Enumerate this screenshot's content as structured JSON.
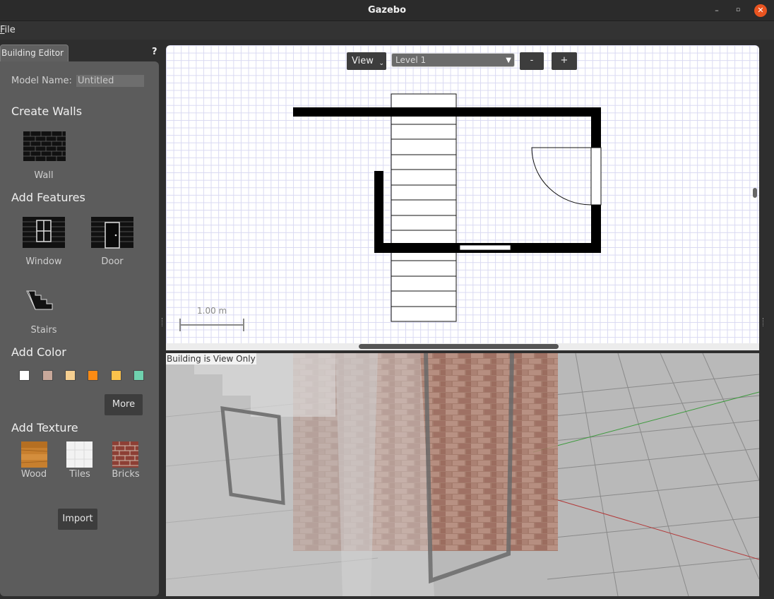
{
  "window": {
    "title": "Gazebo",
    "minimize_label": "–",
    "maximize_label": "▫",
    "close_label": "✕"
  },
  "menu": {
    "file_first": "F",
    "file_rest": "ile"
  },
  "tab": {
    "label": "Building Editor",
    "help_label": "?"
  },
  "panel": {
    "model_name_label": "Model Name:",
    "model_name_value": "Untitled",
    "create_walls_title": "Create Walls",
    "wall_label": "Wall",
    "add_features_title": "Add Features",
    "window_label": "Window",
    "door_label": "Door",
    "stairs_label": "Stairs",
    "add_color_title": "Add Color",
    "colors": [
      "#ffffff",
      "#c8a89a",
      "#f5cf91",
      "#fb8b14",
      "#fbc24b",
      "#6fd1ae"
    ],
    "more_label": "More",
    "add_texture_title": "Add Texture",
    "textures": [
      {
        "label": "Wood",
        "icon": "wood-texture-icon"
      },
      {
        "label": "Tiles",
        "icon": "tiles-texture-icon"
      },
      {
        "label": "Bricks",
        "icon": "bricks-texture-icon"
      }
    ],
    "import_label": "Import"
  },
  "view2d": {
    "view_label": "View",
    "level_label": "Level 1",
    "zoom_out_label": "-",
    "zoom_in_label": "+",
    "scale_label": "1.00 m"
  },
  "view3d": {
    "status": "Building is View Only"
  }
}
